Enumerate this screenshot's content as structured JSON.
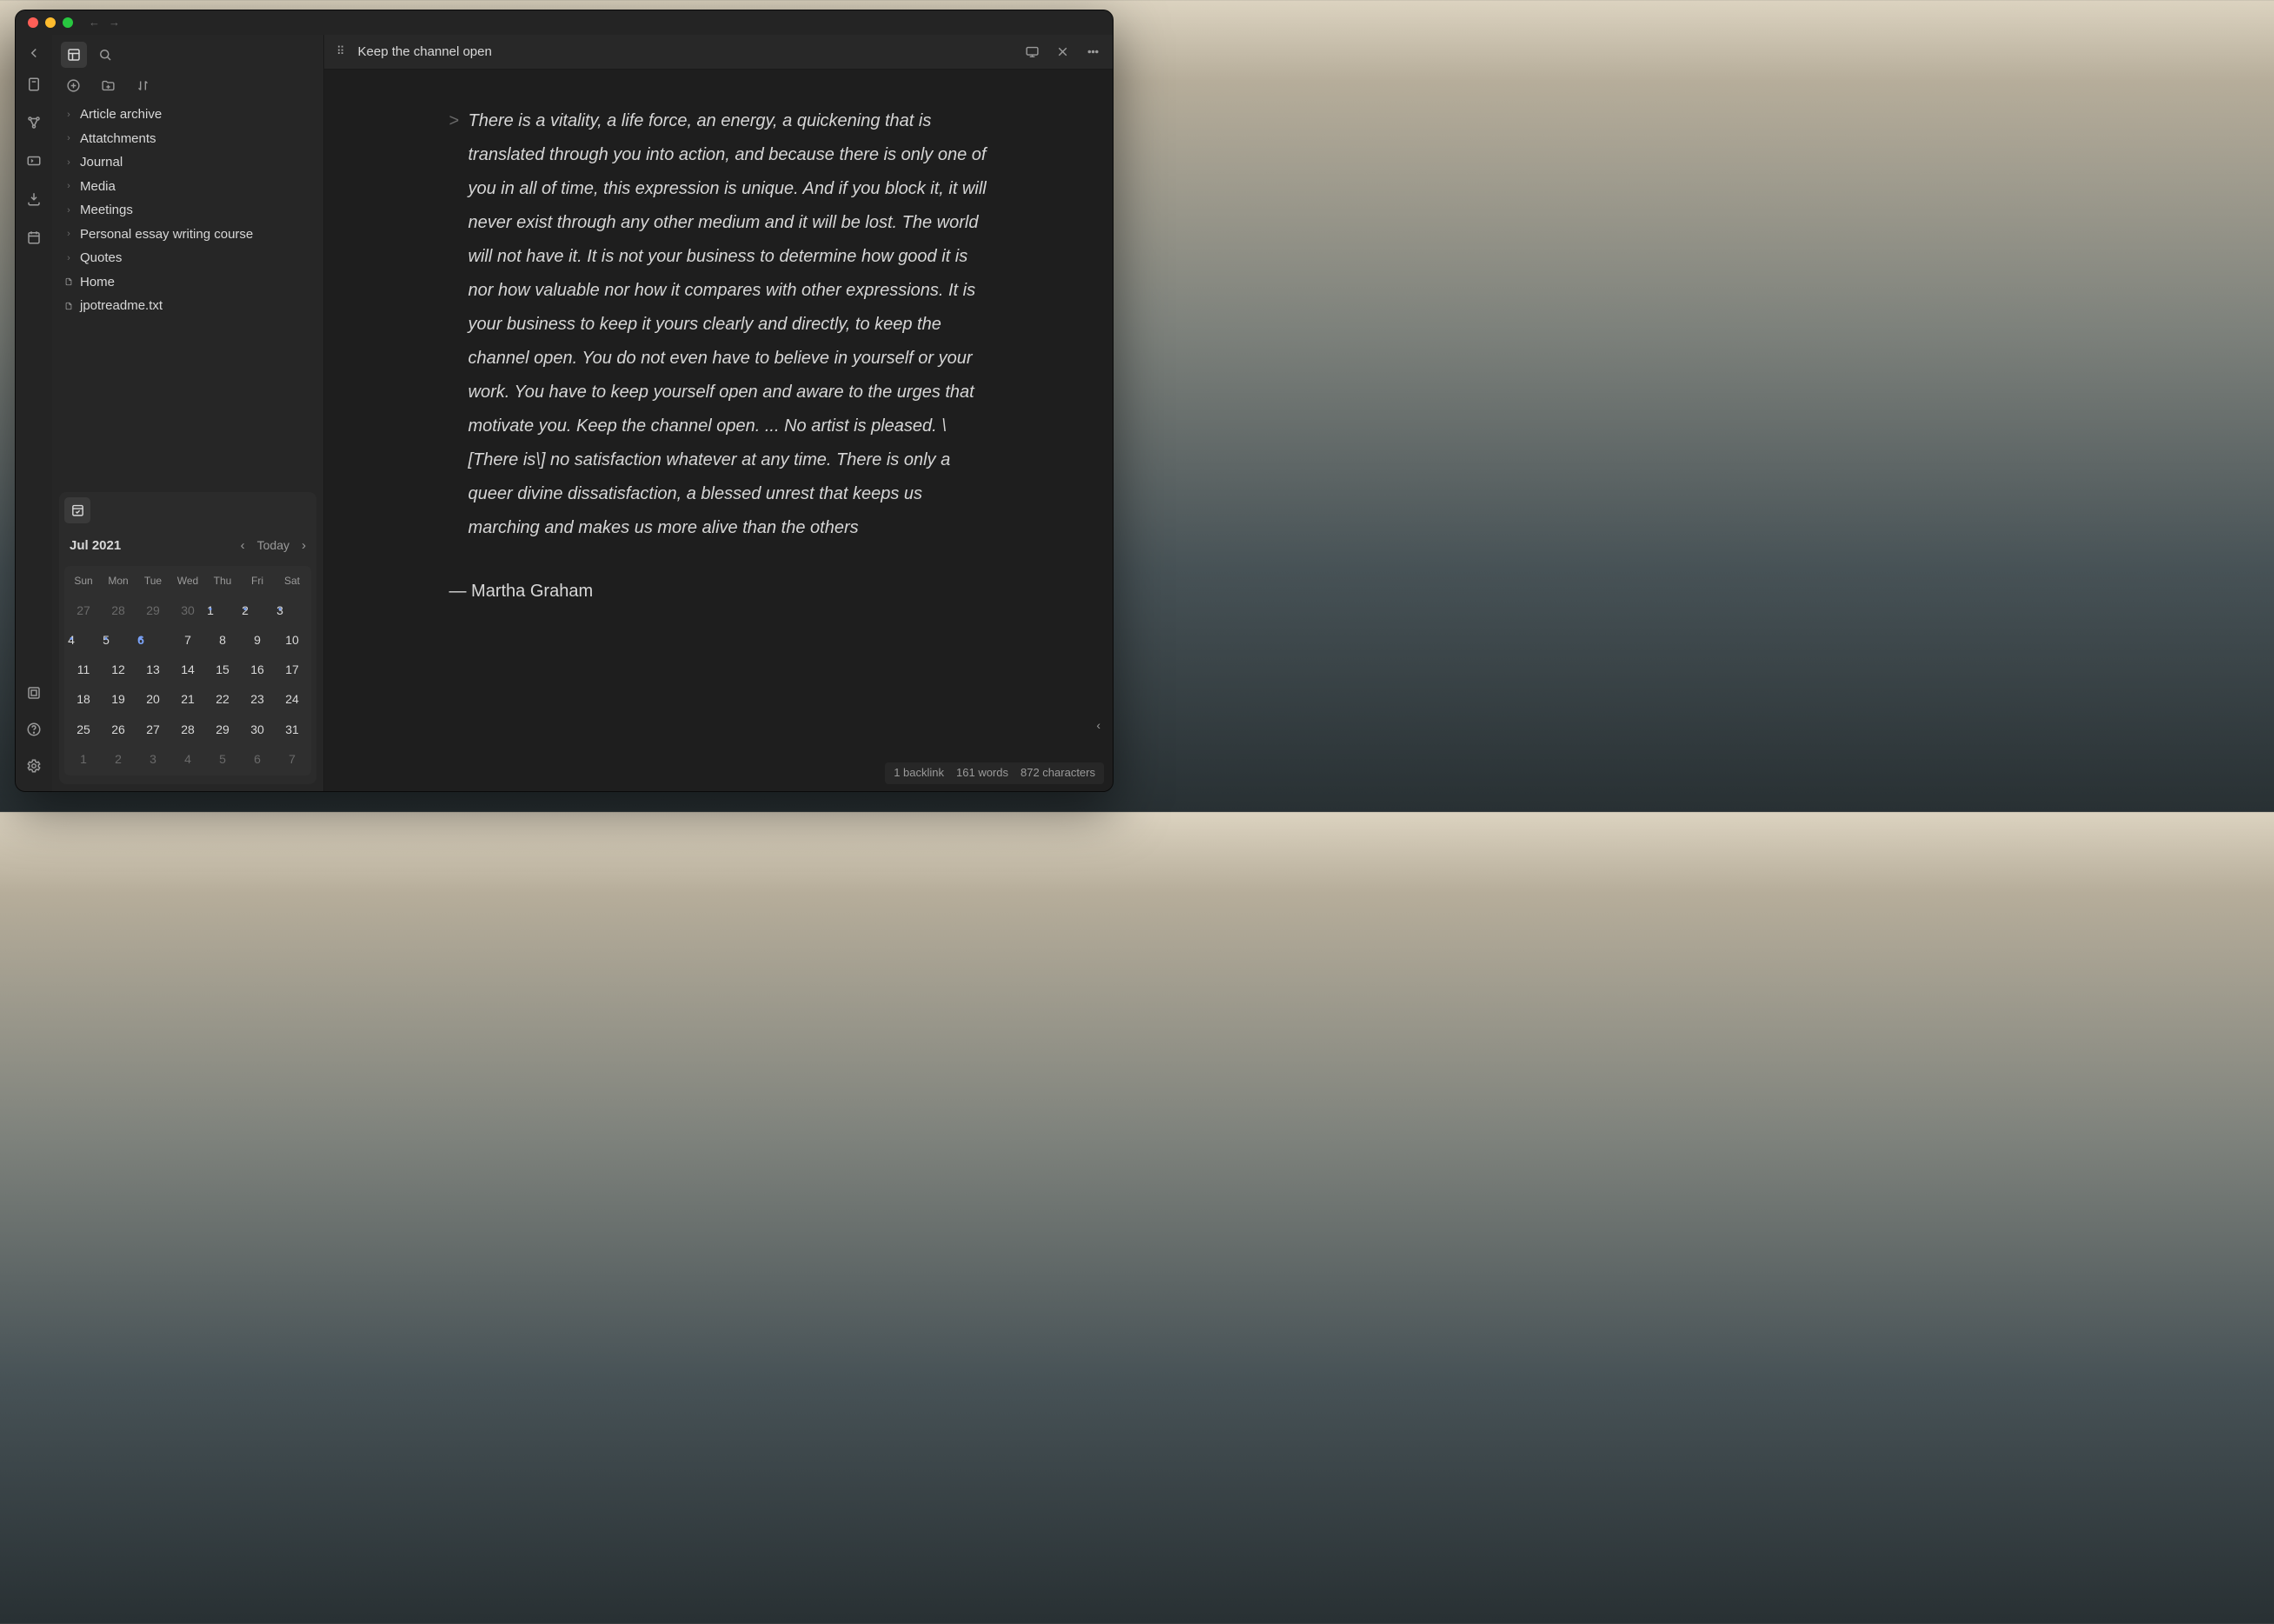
{
  "title": "Keep the channel open",
  "sidebar": {
    "tools": [
      "files",
      "search"
    ],
    "actions": [
      "new-note",
      "new-folder",
      "sort"
    ],
    "tree": [
      {
        "type": "folder",
        "label": "Article archive"
      },
      {
        "type": "folder",
        "label": "Attatchments"
      },
      {
        "type": "folder",
        "label": "Journal"
      },
      {
        "type": "folder",
        "label": "Media"
      },
      {
        "type": "folder",
        "label": "Meetings"
      },
      {
        "type": "folder",
        "label": "Personal essay writing course"
      },
      {
        "type": "folder",
        "label": "Quotes"
      },
      {
        "type": "file",
        "label": "Home"
      },
      {
        "type": "file",
        "label": "jpotreadme.txt"
      }
    ]
  },
  "calendar": {
    "month_label": "Jul 2021",
    "today_label": "Today",
    "day_headers": [
      "Sun",
      "Mon",
      "Tue",
      "Wed",
      "Thu",
      "Fri",
      "Sat"
    ],
    "days": [
      {
        "d": "27",
        "out": true
      },
      {
        "d": "28",
        "out": true
      },
      {
        "d": "29",
        "out": true
      },
      {
        "d": "30",
        "out": true
      },
      {
        "d": "1",
        "dot": true
      },
      {
        "d": "2",
        "dot": true
      },
      {
        "d": "3",
        "dot": true
      },
      {
        "d": "4",
        "dot": true
      },
      {
        "d": "5",
        "dot": true
      },
      {
        "d": "6",
        "sel": true,
        "dot": true
      },
      {
        "d": "7"
      },
      {
        "d": "8"
      },
      {
        "d": "9"
      },
      {
        "d": "10"
      },
      {
        "d": "11"
      },
      {
        "d": "12"
      },
      {
        "d": "13"
      },
      {
        "d": "14"
      },
      {
        "d": "15"
      },
      {
        "d": "16"
      },
      {
        "d": "17"
      },
      {
        "d": "18"
      },
      {
        "d": "19"
      },
      {
        "d": "20"
      },
      {
        "d": "21"
      },
      {
        "d": "22"
      },
      {
        "d": "23"
      },
      {
        "d": "24"
      },
      {
        "d": "25"
      },
      {
        "d": "26"
      },
      {
        "d": "27"
      },
      {
        "d": "28"
      },
      {
        "d": "29"
      },
      {
        "d": "30"
      },
      {
        "d": "31"
      },
      {
        "d": "1",
        "out": true
      },
      {
        "d": "2",
        "out": true
      },
      {
        "d": "3",
        "out": true
      },
      {
        "d": "4",
        "out": true
      },
      {
        "d": "5",
        "out": true
      },
      {
        "d": "6",
        "out": true
      },
      {
        "d": "7",
        "out": true
      }
    ]
  },
  "note": {
    "quote": "There is a vitality, a life force, an energy, a quickening that is translated through you into action, and because there is only one of you in all of time, this expression is unique. And if you block it, it will never exist through any other medium and it will be lost. The world will not have it. It is not your business to determine how good it is nor how valuable nor how it compares with other expressions. It is your business to keep it yours clearly and directly, to keep the channel open. You do not even have to believe in yourself or your work. You have to keep yourself open and aware to the urges that motivate you. Keep the channel open. ... No artist is pleased. \\[There is\\] no satisfaction whatever at any time. There is only a queer divine dissatisfaction, a blessed unrest that keeps us marching and makes us more alive than the others",
    "attribution": "— Martha Graham"
  },
  "status": {
    "backlinks": "1 backlink",
    "words": "161 words",
    "characters": "872 characters"
  }
}
